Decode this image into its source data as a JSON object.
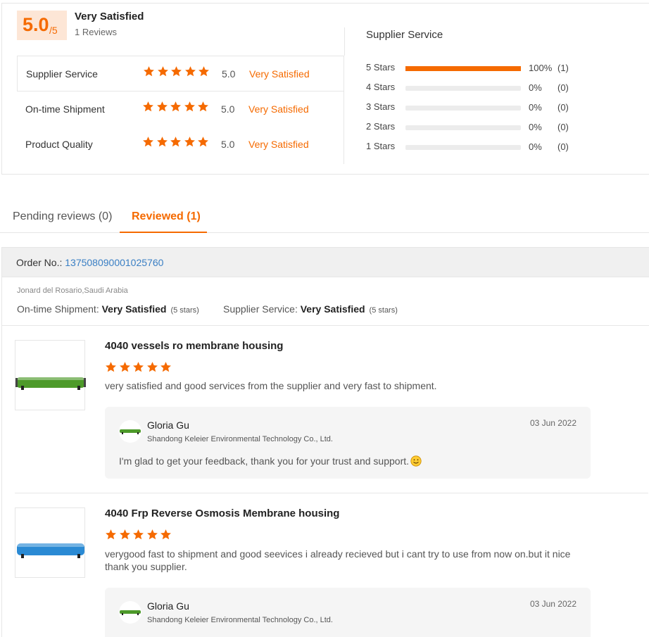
{
  "summary": {
    "score": "5.0",
    "score_of": "/5",
    "title": "Very Satisfied",
    "reviews": "1 Reviews",
    "rows": [
      {
        "label": "Supplier Service",
        "rating": 5,
        "score": "5.0",
        "status": "Very Satisfied"
      },
      {
        "label": "On-time Shipment",
        "rating": 5,
        "score": "5.0",
        "status": "Very Satisfied"
      },
      {
        "label": "Product Quality",
        "rating": 5,
        "score": "5.0",
        "status": "Very Satisfied"
      }
    ]
  },
  "distribution": {
    "title": "Supplier Service",
    "rows": [
      {
        "label": "5  Stars",
        "fraction": 1.0,
        "pct": "100%",
        "count": "(1)"
      },
      {
        "label": "4  Stars",
        "fraction": 0,
        "pct": "0%",
        "count": "(0)"
      },
      {
        "label": "3  Stars",
        "fraction": 0,
        "pct": "0%",
        "count": "(0)"
      },
      {
        "label": "2  Stars",
        "fraction": 0,
        "pct": "0%",
        "count": "(0)"
      },
      {
        "label": "1  Stars",
        "fraction": 0,
        "pct": "0%",
        "count": "(0)"
      }
    ]
  },
  "tabs": {
    "pending": "Pending reviews (0)",
    "reviewed": "Reviewed (1)"
  },
  "order": {
    "label": "Order No.: ",
    "number": "137508090001025760",
    "buyer": "Jonard del Rosario,Saudi Arabia",
    "shipment_label": "On-time Shipment: ",
    "shipment_value": "Very Satisfied",
    "shipment_stars": "(5 stars)",
    "service_label": "Supplier Service: ",
    "service_value": "Very Satisfied",
    "service_stars": "(5 stars)"
  },
  "products": [
    {
      "name": "4040 vessels ro membrane housing",
      "rating": 5,
      "review": "very satisfied and good services from the supplier and very fast to shipment.",
      "thumb_color": "#4d9a2a",
      "reply": {
        "name": "Gloria Gu",
        "company": "Shandong Keleier Environmental Technology Co., Ltd.",
        "date": "03 Jun 2022",
        "message": "I'm glad to get your feedback, thank you for your trust and support."
      }
    },
    {
      "name": "4040 Frp Reverse Osmosis Membrane housing",
      "rating": 5,
      "review": "verygood fast to shipment and good seevices i already recieved but i cant try to use from now on.but it nice thank you supplier.",
      "thumb_color": "#2a8ad4",
      "reply": {
        "name": "Gloria Gu",
        "company": "Shandong Keleier Environmental Technology Co., Ltd.",
        "date": "03 Jun 2022"
      }
    }
  ],
  "colors": {
    "accent": "#f56a00",
    "link": "#3a7fc4"
  }
}
